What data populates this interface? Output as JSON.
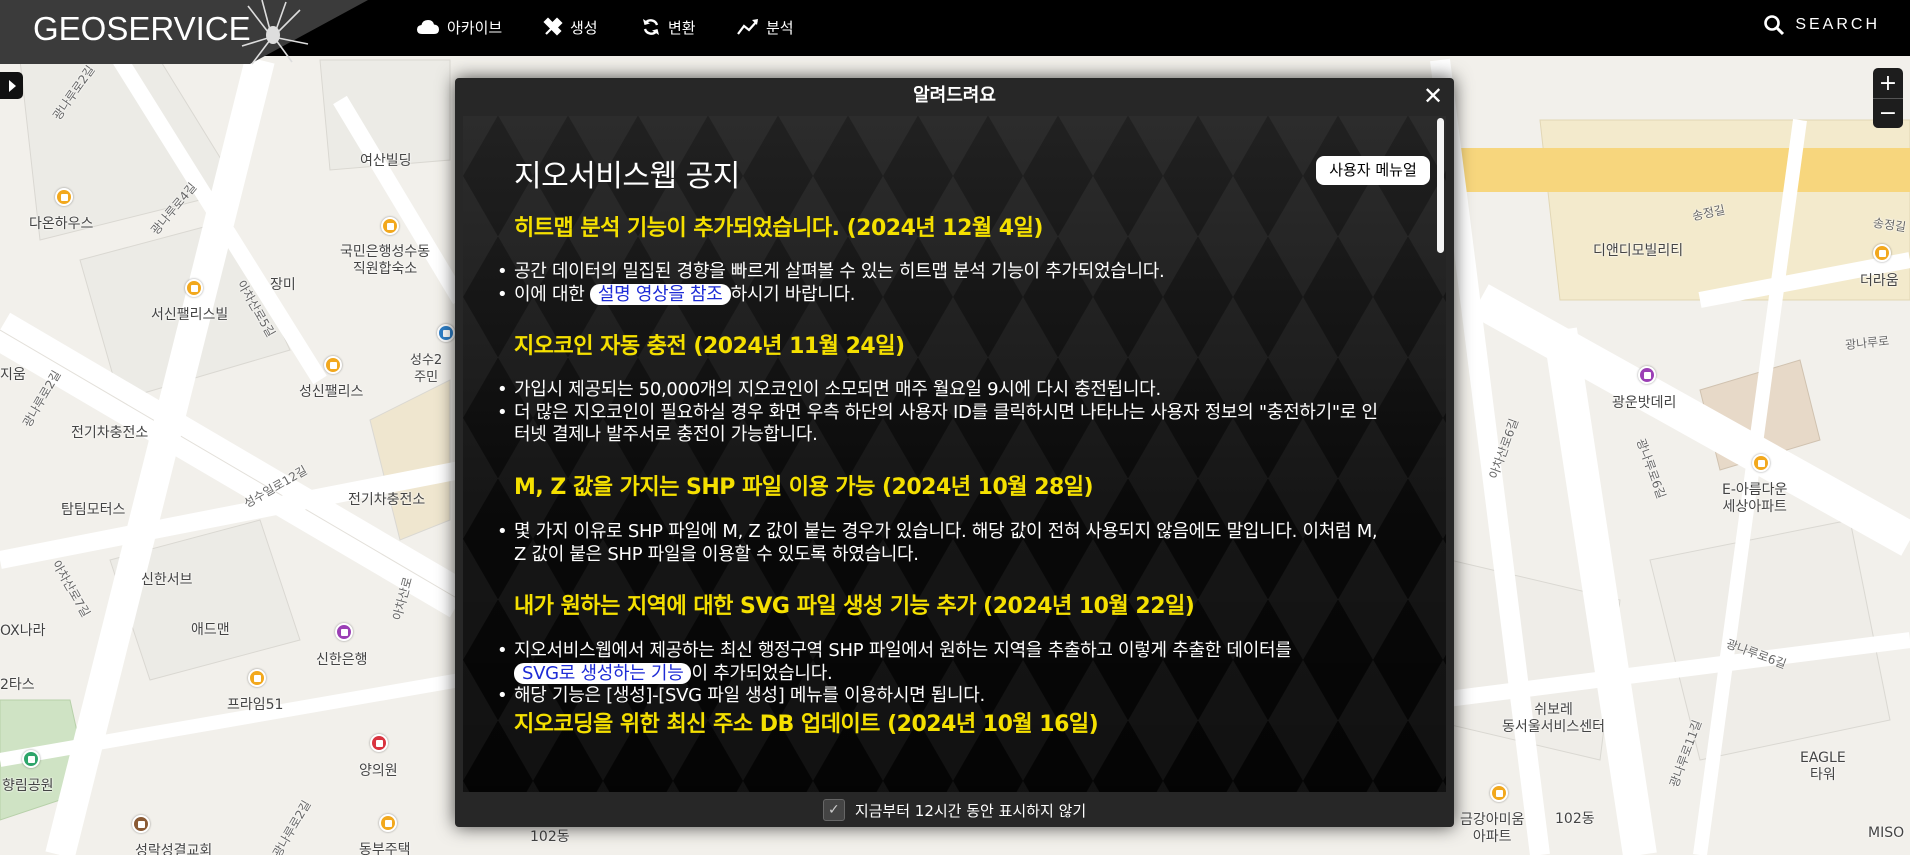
{
  "app": {
    "logo": "GEOSERVICE",
    "nav": [
      {
        "label": "아카이브",
        "icon": "cloud-icon"
      },
      {
        "label": "생성",
        "icon": "tools-icon"
      },
      {
        "label": "변환",
        "icon": "refresh-icon"
      },
      {
        "label": "분석",
        "icon": "chart-icon"
      }
    ],
    "search_label": "SEARCH",
    "zoom_in": "+",
    "zoom_out": "−"
  },
  "map": {
    "labels": [
      "여산빌딩",
      "다온하우스",
      "국민은행성수동\n직원합숙소",
      "장미",
      "서신팰리스빌",
      "성신팰리스",
      "전기차충전소",
      "전기차충전소",
      "탐팀모터스",
      "신한서브",
      "애드맨",
      "신한은행",
      "프라임51",
      "양의원",
      "동부주택",
      "성락성결교회",
      "102동",
      "디앤디모빌리티",
      "더라움",
      "광운밧데리",
      "E-아름다운\n세상아파트",
      "쉬보레\n동서울서비스센터",
      "EAGLE\n타워",
      "금강아미움\n아파트",
      "102동",
      "MISO",
      "지움",
      "OX나라",
      "2타스",
      "향림공원",
      "성수2\n주민",
      "송정길",
      "송정길",
      "광나루로",
      "광나루로6길",
      "광나루로2길",
      "광나루로4길",
      "성수일로12길",
      "아차산로5길",
      "아차산로7길",
      "아차산로",
      "광나루로6길",
      "광나루로11길",
      "아차산로6길",
      "광나루로2길",
      "광나루로2길",
      "아차산로15길"
    ],
    "poi_colors": {
      "orange": "#f2a81d",
      "purple": "#9b3fb5",
      "blue": "#2f80c9",
      "red": "#d9333f",
      "green": "#2ea56a"
    }
  },
  "modal": {
    "title": "알려드려요",
    "notice_title": "지오서비스웹 공지",
    "manual_button": "사용자 메뉴얼",
    "sections": [
      {
        "title": "히트맵 분석 기능이 추가되었습니다. (2024년 12월 4일)",
        "items": [
          {
            "text": "공간 데이터의 밀집된 경향을 빠르게 살펴볼 수 있는 히트맵 분석 기능이 추가되었습니다."
          },
          {
            "pre": "이에 대한 ",
            "link": "설명 영상을 참조",
            "post": "하시기 바랍니다."
          }
        ]
      },
      {
        "title": "지오코인 자동 충전 (2024년 11월 24일)",
        "items": [
          {
            "text": "가입시 제공되는 50,000개의 지오코인이 소모되면 매주 월요일 9시에 다시 충전됩니다."
          },
          {
            "text": "더 많은 지오코인이 필요하실 경우 화면 우측 하단의 사용자 ID를 클릭하시면 나타나는 사용자 정보의 \"충전하기\"로 인터넷 결제나 발주서로 충전이 가능합니다."
          }
        ]
      },
      {
        "title": "M, Z 값을 가지는 SHP 파일 이용 가능 (2024년 10월 28일)",
        "items": [
          {
            "text": "몇 가지 이유로 SHP 파일에 M, Z 값이 붙는 경우가 있습니다. 해당 값이 전혀 사용되지 않음에도 말입니다. 이처럼 M, Z 값이 붙은 SHP 파일을 이용할 수 있도록 하였습니다."
          }
        ]
      },
      {
        "title": "내가 원하는 지역에 대한 SVG 파일 생성 기능 추가 (2024년 10월 22일)",
        "items": [
          {
            "pre": "지오서비스웹에서 제공하는 최신 행정구역 SHP 파일에서 원하는 지역을 추출하고 이렇게 추출한 데이터를 ",
            "link": "SVG로 생성하는 기능",
            "post": "이 추가되었습니다."
          },
          {
            "text": "해당 기능은 [생성]-[SVG 파일 생성] 메뉴를 이용하시면 됩니다."
          }
        ]
      },
      {
        "title": "지오코딩을 위한 최신 주소 DB 업데이트 (2024년 10월 16일)",
        "items": []
      }
    ],
    "footer_checkbox_label": "지금부터 12시간 동안 표시하지 않기"
  }
}
